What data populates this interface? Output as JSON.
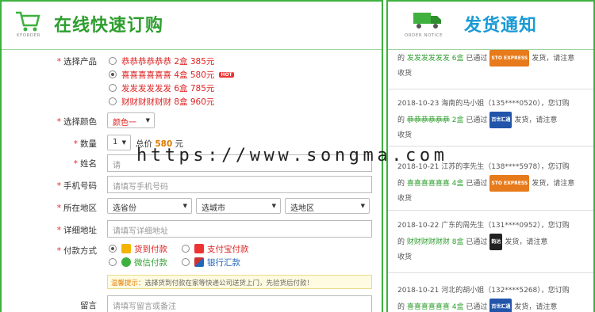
{
  "order": {
    "header_caption": "KFORDER",
    "title": "在线快速订购",
    "product_label": "选择产品",
    "products": [
      {
        "name": "恭恭恭恭恭恭",
        "qty": "2盒",
        "price": "385元",
        "selected": false,
        "hot": false
      },
      {
        "name": "喜喜喜喜喜喜",
        "qty": "4盒",
        "price": "580元",
        "selected": true,
        "hot": true
      },
      {
        "name": "发发发发发发",
        "qty": "6盒",
        "price": "785元",
        "selected": false,
        "hot": false
      },
      {
        "name": "财财财财财财",
        "qty": "8盒",
        "price": "960元",
        "selected": false,
        "hot": false
      }
    ],
    "hot_badge": "HOT",
    "color_label": "选择颜色",
    "color_value": "颜色一",
    "qty_label": "数量",
    "qty_value": "1",
    "total_prefix": "总价",
    "total_value": "580",
    "total_suffix": "元",
    "name_label": "姓名",
    "name_value": "请",
    "phone_label": "手机号码",
    "phone_placeholder": "请填写手机号码",
    "region_label": "所在地区",
    "province": "选省份",
    "city": "选城市",
    "district": "选地区",
    "address_label": "详细地址",
    "address_placeholder": "请填写详细地址",
    "pay_label": "付款方式",
    "pay_cod": "货到付款",
    "pay_alipay": "支付宝付款",
    "pay_wechat": "微信付款",
    "pay_bank": "银行汇款",
    "tip_head": "温馨提示：",
    "tip_text": "选择货到付款在家等快递公司送货上门，先验货后付款！",
    "note_label": "留言",
    "note_placeholder": "请填写留言或备注"
  },
  "notice": {
    "header_caption": "ORDER NOTICE",
    "title": "发货通知",
    "items": [
      {
        "line1_pre": "的",
        "product": "发发发发发发",
        "qty": "6盒",
        "line1_post": "已通过",
        "courier": "STO EXPRESS",
        "courier_class": "c-sto",
        "tail": "发货，请注意",
        "line2": "收货",
        "date": "",
        "who": ""
      },
      {
        "date": "2018-10-23",
        "who": "海南的马小姐（135****0520），您订购",
        "line1_pre": "的",
        "product": "恭恭恭恭恭恭",
        "qty": "2盒",
        "line1_post": "已通过",
        "courier": "百世汇通",
        "courier_class": "c-jd",
        "tail": "发货，请注意",
        "line2": "收货"
      },
      {
        "date": "2018-10-21",
        "who": "江苏的李先生（138****5978），您订购",
        "line1_pre": "的",
        "product": "喜喜喜喜喜喜",
        "qty": "4盒",
        "line1_post": "已通过",
        "courier": "STO EXPRESS",
        "courier_class": "c-sto",
        "tail": "发货，请注意",
        "line2": "收货"
      },
      {
        "date": "2018-10-22",
        "who": "广东的周先生（131****0952），您订购",
        "line1_pre": "的",
        "product": "财财财财财财",
        "qty": "8盒",
        "line1_post": "已通过",
        "courier": "韵达",
        "courier_class": "c-yd",
        "tail": "发货，请注意",
        "line2": "收货"
      },
      {
        "date": "2018-10-21",
        "who": "河北的胡小姐（132****5268），您订购",
        "line1_pre": "的",
        "product": "喜喜喜喜喜喜",
        "qty": "4盒",
        "line1_post": "已通过",
        "courier": "百世汇通",
        "courier_class": "c-jd",
        "tail": "发货，请注意",
        "line2": ""
      }
    ]
  },
  "watermark": "https://www.songma.com",
  "colors": {
    "green": "#3eb13e",
    "red": "#dd2222",
    "blue": "#1a9ad6"
  },
  "icons": [
    "cart-icon",
    "truck-icon",
    "coins-icon",
    "alipay-icon",
    "wechat-icon",
    "bank-card-icon",
    "hot-flame-icon"
  ]
}
